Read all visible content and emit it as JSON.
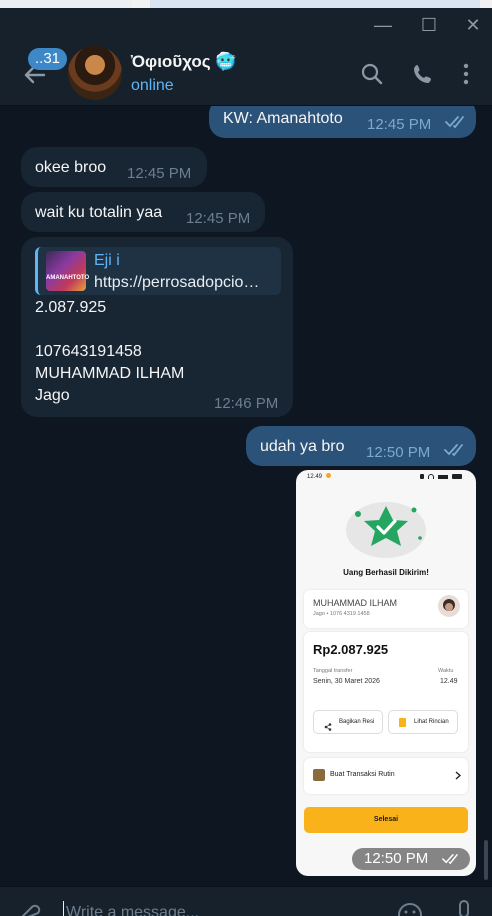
{
  "window": {
    "minimize": "—",
    "maximize": "☐",
    "close": "✕"
  },
  "header": {
    "unread_count": "..31",
    "chat_name": "Ὀφιοῦχος 🥶",
    "status": "online"
  },
  "messages": [
    {
      "dir": "out",
      "text": "KW: Amanahtoto",
      "time": "12:45 PM"
    },
    {
      "dir": "in",
      "text": "okee broo",
      "time": "12:45 PM"
    },
    {
      "dir": "in",
      "text": "wait ku totalin yaa",
      "time": "12:45 PM"
    },
    {
      "dir": "in",
      "reply_name": "Eji i",
      "reply_text": "https://perrosadopcio…",
      "reply_thumb_label": "AMANAHTOTO",
      "lines": [
        "2.087.925",
        "",
        "107643191458",
        "MUHAMMAD ILHAM",
        "Jago"
      ],
      "time": "12:46 PM"
    },
    {
      "dir": "out",
      "text": "udah ya bro",
      "time": "12:50 PM"
    }
  ],
  "receipt": {
    "status_time": "12.49",
    "title": "Uang Berhasil Dikirim!",
    "recipient_name": "MUHAMMAD ILHAM",
    "recipient_account": "Jago • 1076 4319 1458",
    "amount": "Rp2.087.925",
    "date_label": "Tanggal transfer",
    "date_value": "Senin, 30 Maret 2026",
    "time_label": "Waktu",
    "time_value": "12.49",
    "share_label": "Bagikan Resi",
    "detail_label": "Lihat Rincian",
    "routine_label": "Buat Transaksi Rutin",
    "done_label": "Selesai",
    "image_time": "12:50 PM"
  },
  "composer": {
    "placeholder": "Write a message..."
  },
  "colors": {
    "bg": "#0e1621",
    "incoming": "#182533",
    "outgoing": "#2b5278",
    "accent": "#5eb5f7",
    "cta": "#f9b21a",
    "check_green": "#25a55f"
  }
}
